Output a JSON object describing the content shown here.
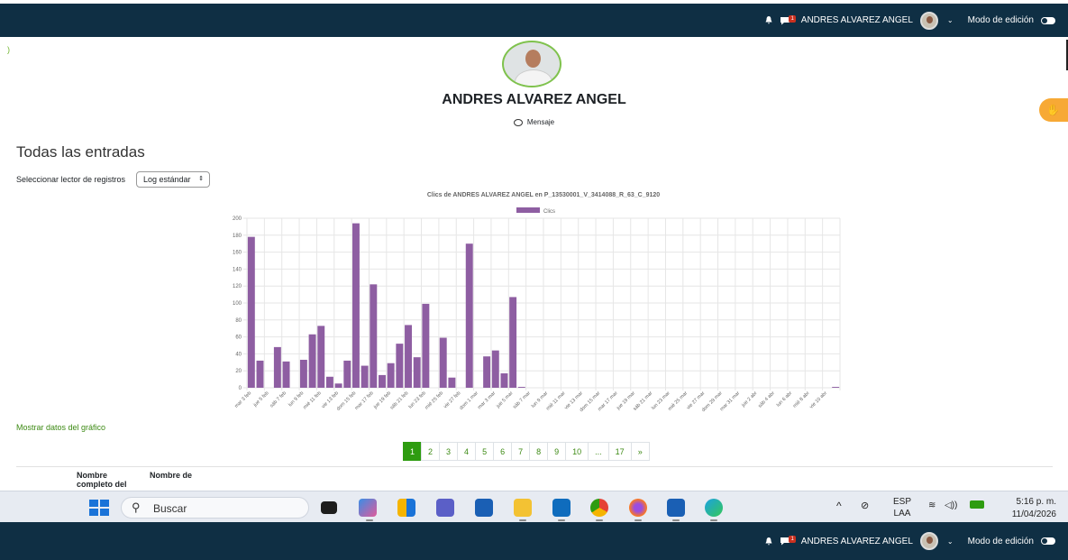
{
  "nav": {
    "user_name": "ANDRES ALVAREZ ANGEL",
    "msg_count": "1",
    "edit_mode": "Modo de edición"
  },
  "profile": {
    "name": "ANDRES ALVAREZ ANGEL",
    "message_label": "Mensaje"
  },
  "page": {
    "heading": "Todas las entradas",
    "reader_label": "Seleccionar lector de registros",
    "reader_value": "Log estándar",
    "show_data": "Mostrar datos del gráfico"
  },
  "chart_data": {
    "type": "bar",
    "title": "Clics de ANDRES ALVAREZ ANGEL  en P_13530001_V_3414088_R_63_C_9120",
    "legend": "Clics",
    "legend_position": "top",
    "color": "#8e5ea2",
    "grid": true,
    "ylim": [
      0,
      200
    ],
    "yticks": [
      0,
      20,
      40,
      60,
      80,
      100,
      120,
      140,
      160,
      180,
      200
    ],
    "categories": [
      "mar 3 feb",
      "mié 4 feb",
      "jue 5 feb",
      "vie 6 feb",
      "sáb 7 feb",
      "dom 8 feb",
      "lun 9 feb",
      "mar 10 feb",
      "mié 11 feb",
      "jue 12 feb",
      "vie 13 feb",
      "sáb 14 feb",
      "dom 15 feb",
      "lun 16 feb",
      "mar 17 feb",
      "mié 18 feb",
      "jue 19 feb",
      "vie 20 feb",
      "sáb 21 feb",
      "dom 22 feb",
      "lun 23 feb",
      "mar 24 feb",
      "mié 25 feb",
      "jue 26 feb",
      "vie 27 feb",
      "sáb 28 feb",
      "dom 1 mar",
      "lun 2 mar",
      "mar 3 mar",
      "mié 4 mar",
      "jue 5 mar",
      "vie 6 mar",
      "sáb 7 mar",
      "dom 8 mar",
      "lun 9 mar",
      "mar 10 mar",
      "mié 11 mar",
      "jue 12 mar",
      "vie 13 mar",
      "sáb 14 mar",
      "dom 15 mar",
      "lun 16 mar",
      "mar 17 mar",
      "mié 18 mar",
      "jue 19 mar",
      "vie 20 mar",
      "sáb 21 mar",
      "dom 22 mar",
      "lun 23 mar",
      "mar 24 mar",
      "mié 25 mar",
      "jue 26 mar",
      "vie 27 mar",
      "sáb 28 mar",
      "dom 29 mar",
      "lun 30 mar",
      "mar 31 mar",
      "mié 1 abr",
      "jue 2 abr",
      "vie 3 abr",
      "sáb 4 abr",
      "dom 5 abr",
      "lun 6 abr",
      "mar 7 abr",
      "mié 8 abr",
      "jue 9 abr",
      "vie 10 abr",
      "sáb 11 abr"
    ],
    "values": [
      178,
      32,
      0,
      48,
      31,
      0,
      33,
      63,
      73,
      13,
      5,
      32,
      194,
      26,
      122,
      15,
      29,
      52,
      74,
      36,
      99,
      0,
      59,
      12,
      0,
      170,
      0,
      37,
      44,
      17,
      107,
      1,
      0,
      0,
      0,
      0,
      0,
      0,
      0,
      0,
      0,
      0,
      0,
      0,
      0,
      0,
      0,
      0,
      0,
      0,
      0,
      0,
      0,
      0,
      0,
      0,
      0,
      0,
      0,
      0,
      0,
      0,
      0,
      0,
      0,
      0,
      0,
      1
    ],
    "label_every": 2
  },
  "pagination": [
    "1",
    "2",
    "3",
    "4",
    "5",
    "6",
    "7",
    "8",
    "9",
    "10",
    "...",
    "17",
    "»"
  ],
  "table": {
    "col1": "Nombre completo del",
    "col2": "Nombre de"
  },
  "taskbar": {
    "search_placeholder": "Buscar",
    "lang1": "ESP",
    "lang2": "LAA",
    "time": "5:16 p. m.",
    "date": "11/04/2026"
  }
}
